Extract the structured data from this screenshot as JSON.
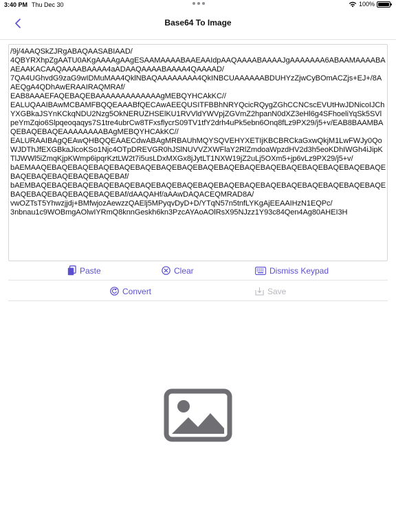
{
  "status_bar": {
    "time": "3:40 PM",
    "date": "Thu Dec 30",
    "battery": "100%"
  },
  "nav": {
    "title": "Base64 To Image",
    "back_icon": "chevron-left-icon"
  },
  "input": {
    "value": "/9j/4AAQSkZJRgABAQAASABIAAD/\n4QBYRXhpZgAATU0AKgAAAAgAAgESAAMAAAABAAEAAIdpAAQAAAABAAAAJgAAAAAAA6ABAAMAAAABAAEAAKACAAQAAAABAAAA4aADAAQAAAABAAAA4QAAAAD/\n7QA4UGhvdG9zaG9wIDMuMAA4QklNBAQAAAAAAAA4QkINBCUAAAAAABDUHYzZjwCyBOmACZjs+EJ+/8AAEQgA4QDhAwERAAIRAQMRAf/\nEAB8AAAEFAQEBAQEBAAAAAAAAAAAAAgMEBQYHCAkKC//\nEALUQAAIBAwMCBAMFBQQEAAABfQECAwAEEQUSITFBBhNRYQcicRQygZGhCCNCscEVUtHwJDNicoIJChYXGBkaJSYnKCkqNDU2Nzg5OkNERUZHSElKU1RVVldYWVpjZGVmZ2hpanN0dXZ3eHl6g4SFhoeliYqSk5SVlpeYmZqio6Slpqeoqaqys7S1tre4ubrCw8TFxsflycrS09TV1tfY2drh4uPk5ebn6Onq8fLz9PX29/j5+v/EAB8BAAMBAQEBAQEBAQEAAAAAAAABAgMEBQYHCAkKC//\nEALURAAIBAgQEAwQHBQQEAAECdwABAgMRBAUhMQYSQVEHYXETIjKBCBRCkaGxwQkjM1LwFWJy0QoWJDThJfEXGBkaJicoKSo1Njc4OTpDREVGR0hJSlNUVVZXWFlaY2RlZmdoaWpzdHV2d3h5eoKDhIWGh4iJipKTlJWWl5iZmqKjpKWmp6ipqrKztLW2t7i5usLDxMXGx8jJytLT1NXW19jZ2uLj5OXm5+jp6vLz9PX29/j5+v/\nbAEMAAQEBAQEBAQEBAQEBAQEBAQEBAQEBAQEBAQEBAQEBAQEBAQEBAQEBAQEBAQEBAQEBAQEBAQEBAQEBAQEBAQEBAQEBAf/\nbAEMBAQEBAQEBAQEBAQEBAQEBAQEBAQEBAQEBAQEBAQEBAQEBAQEBAQEBAQEBAQEBAQEBAQEBAQEBAQEBAQEBAQEBAQEBAf/dAAQAHf/aAAwDAQACEQMRAD8A/\nvwOZTsT5Yhwzjjdj+BMfwjozAewzzQAElj5MPyqvDyD+D/YTqN57n5tnfLYKgAjEEAAIHzN1EQPc/\n3nbnau1c9WOBmgAOlwIYRmQ8knnGeskh6kn3PzcAYAoAOlRsX95NJzz1Y93c84Qen4Ag80AHEI3H"
  },
  "buttons": {
    "paste": "Paste",
    "clear": "Clear",
    "dismiss_keypad": "Dismiss Keypad",
    "convert": "Convert",
    "save": "Save"
  },
  "colors": {
    "accent": "#5b4fcf",
    "disabled": "#b8b8bd",
    "placeholder_icon": "#6e6e73"
  }
}
